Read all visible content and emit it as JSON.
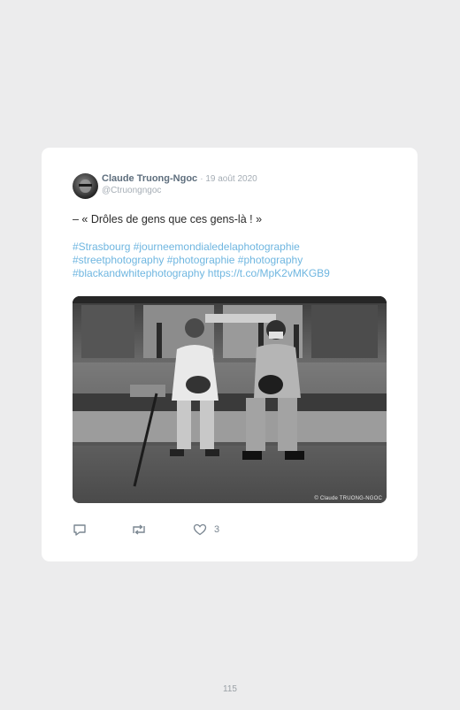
{
  "tweet": {
    "author_name": "Claude Truong-Ngoc",
    "date": "· 19 août 2020",
    "handle": "@Ctruongngoc",
    "text": "– « Drôles de gens que ces gens-là ! »",
    "hashtag_lines": [
      "#Strasbourg #journeemondialedelaphotographie",
      "#streetphotography #photographie #photography",
      "#blackandwhitephotography https://t.co/MpK2vMKGB9"
    ],
    "photo_credit": "© Claude TRUONG-NGOC",
    "like_count": "3"
  },
  "icons": {
    "reply": "reply-icon",
    "retweet": "retweet-icon",
    "like": "heart-icon"
  },
  "colors": {
    "page_background": "#ececed",
    "card_background": "#ffffff",
    "link": "#6fb6e0",
    "author": "#5e6e7d",
    "muted": "#a5adb5"
  },
  "page_number": "115"
}
